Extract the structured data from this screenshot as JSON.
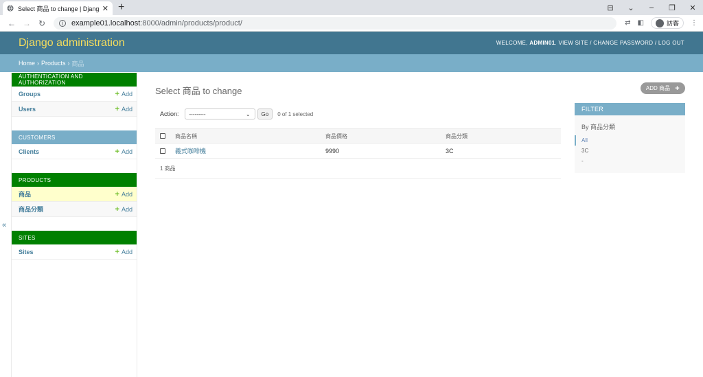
{
  "browser": {
    "tab_title": "Select 商品 to change | Djang",
    "tab_close": "✕",
    "new_tab": "+",
    "url_host": "example01.localhost",
    "url_path": ":8000/admin/products/product/",
    "guest_label": "訪客",
    "window_controls": [
      "⊟",
      "⌄",
      "–",
      "❐",
      "✕"
    ]
  },
  "header": {
    "brand": "Django administration",
    "welcome": "WELCOME,",
    "username": "ADMIN01",
    "view_site": "VIEW SITE",
    "change_password": "CHANGE PASSWORD",
    "logout": "LOG OUT",
    "sep": "/"
  },
  "breadcrumbs": {
    "home": "Home",
    "app": "Products",
    "current": "商品",
    "sep": "›"
  },
  "sidebar": {
    "collapse": "«",
    "add_label": "Add",
    "modules": [
      {
        "caption": "AUTHENTICATION AND AUTHORIZATION",
        "items": [
          "Groups",
          "Users"
        ]
      },
      {
        "caption": "CUSTOMERS",
        "items": [
          "Clients"
        ]
      },
      {
        "caption": "PRODUCTS",
        "items": [
          "商品",
          "商品分類"
        ]
      },
      {
        "caption": "SITES",
        "items": [
          "Sites"
        ]
      }
    ]
  },
  "content": {
    "title": "Select 商品 to change",
    "add_button": "ADD 商品",
    "add_icon": "+",
    "action_label": "Action:",
    "action_select_value": "---------",
    "go_button": "Go",
    "selected_count": "0 of 1 selected",
    "columns": [
      "商品名稱",
      "商品價格",
      "商品分類"
    ],
    "rows": [
      {
        "name": "義式咖啡機",
        "price": "9990",
        "category": "3C"
      }
    ],
    "paginator": "1 商品"
  },
  "filter": {
    "title": "FILTER",
    "heading": "By 商品分類",
    "options": [
      "All",
      "3C",
      "-"
    ]
  },
  "colors": {
    "header_bg": "#417690",
    "brand": "#f5dd5d",
    "breadcrumb_bg": "#79aec8",
    "module_green": "#008000",
    "link": "#447e9b",
    "add_plus": "#70bf2b"
  }
}
